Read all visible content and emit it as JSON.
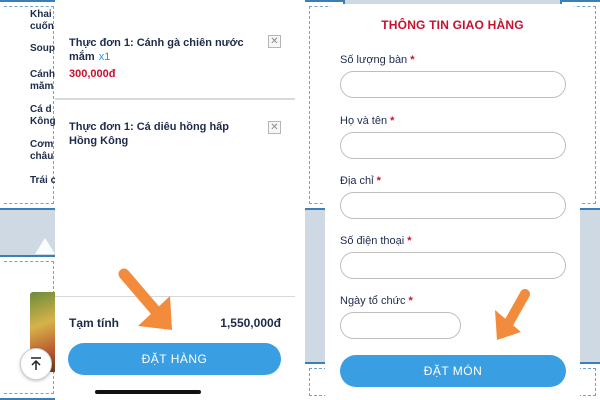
{
  "left_screen": {
    "background_menu": [
      "Khai",
      "cuốn",
      "Soup",
      "Cánh",
      "mắm",
      "Cá d",
      "Kông",
      "Cơm",
      "châu",
      "Trái c"
    ],
    "cart": {
      "items": [
        {
          "name": "Thực đơn 1: Cánh gà chiên nước mắm",
          "quantity": "x1",
          "price": "300,000đ"
        },
        {
          "name": "Thực đơn 1: Cá diêu hồng hấp Hồng Kông"
        }
      ],
      "remove_symbol": "✕",
      "subtotal_label": "Tạm tính",
      "subtotal_value": "1,550,000đ",
      "order_button": "ĐẶT HÀNG"
    },
    "scroll_top_icon": "arrow-up-to-line-icon"
  },
  "right_screen": {
    "form": {
      "title": "THÔNG TIN GIAO HÀNG",
      "fields": [
        {
          "label": "Số lượng bàn",
          "required_mark": "*",
          "value": ""
        },
        {
          "label": "Họ và tên",
          "required_mark": "*",
          "value": ""
        },
        {
          "label": "Địa chỉ",
          "required_mark": "*",
          "value": ""
        },
        {
          "label": "Số điện thoại",
          "required_mark": "*",
          "value": ""
        },
        {
          "label": "Ngày tổ chức",
          "required_mark": "*",
          "value": ""
        }
      ],
      "submit_button": "ĐẶT MÓN"
    }
  },
  "colors": {
    "accent_blue": "#3a9ee3",
    "title_red": "#c8102e",
    "arrow_orange": "#f28c3c",
    "text_navy": "#1d2b4a"
  }
}
